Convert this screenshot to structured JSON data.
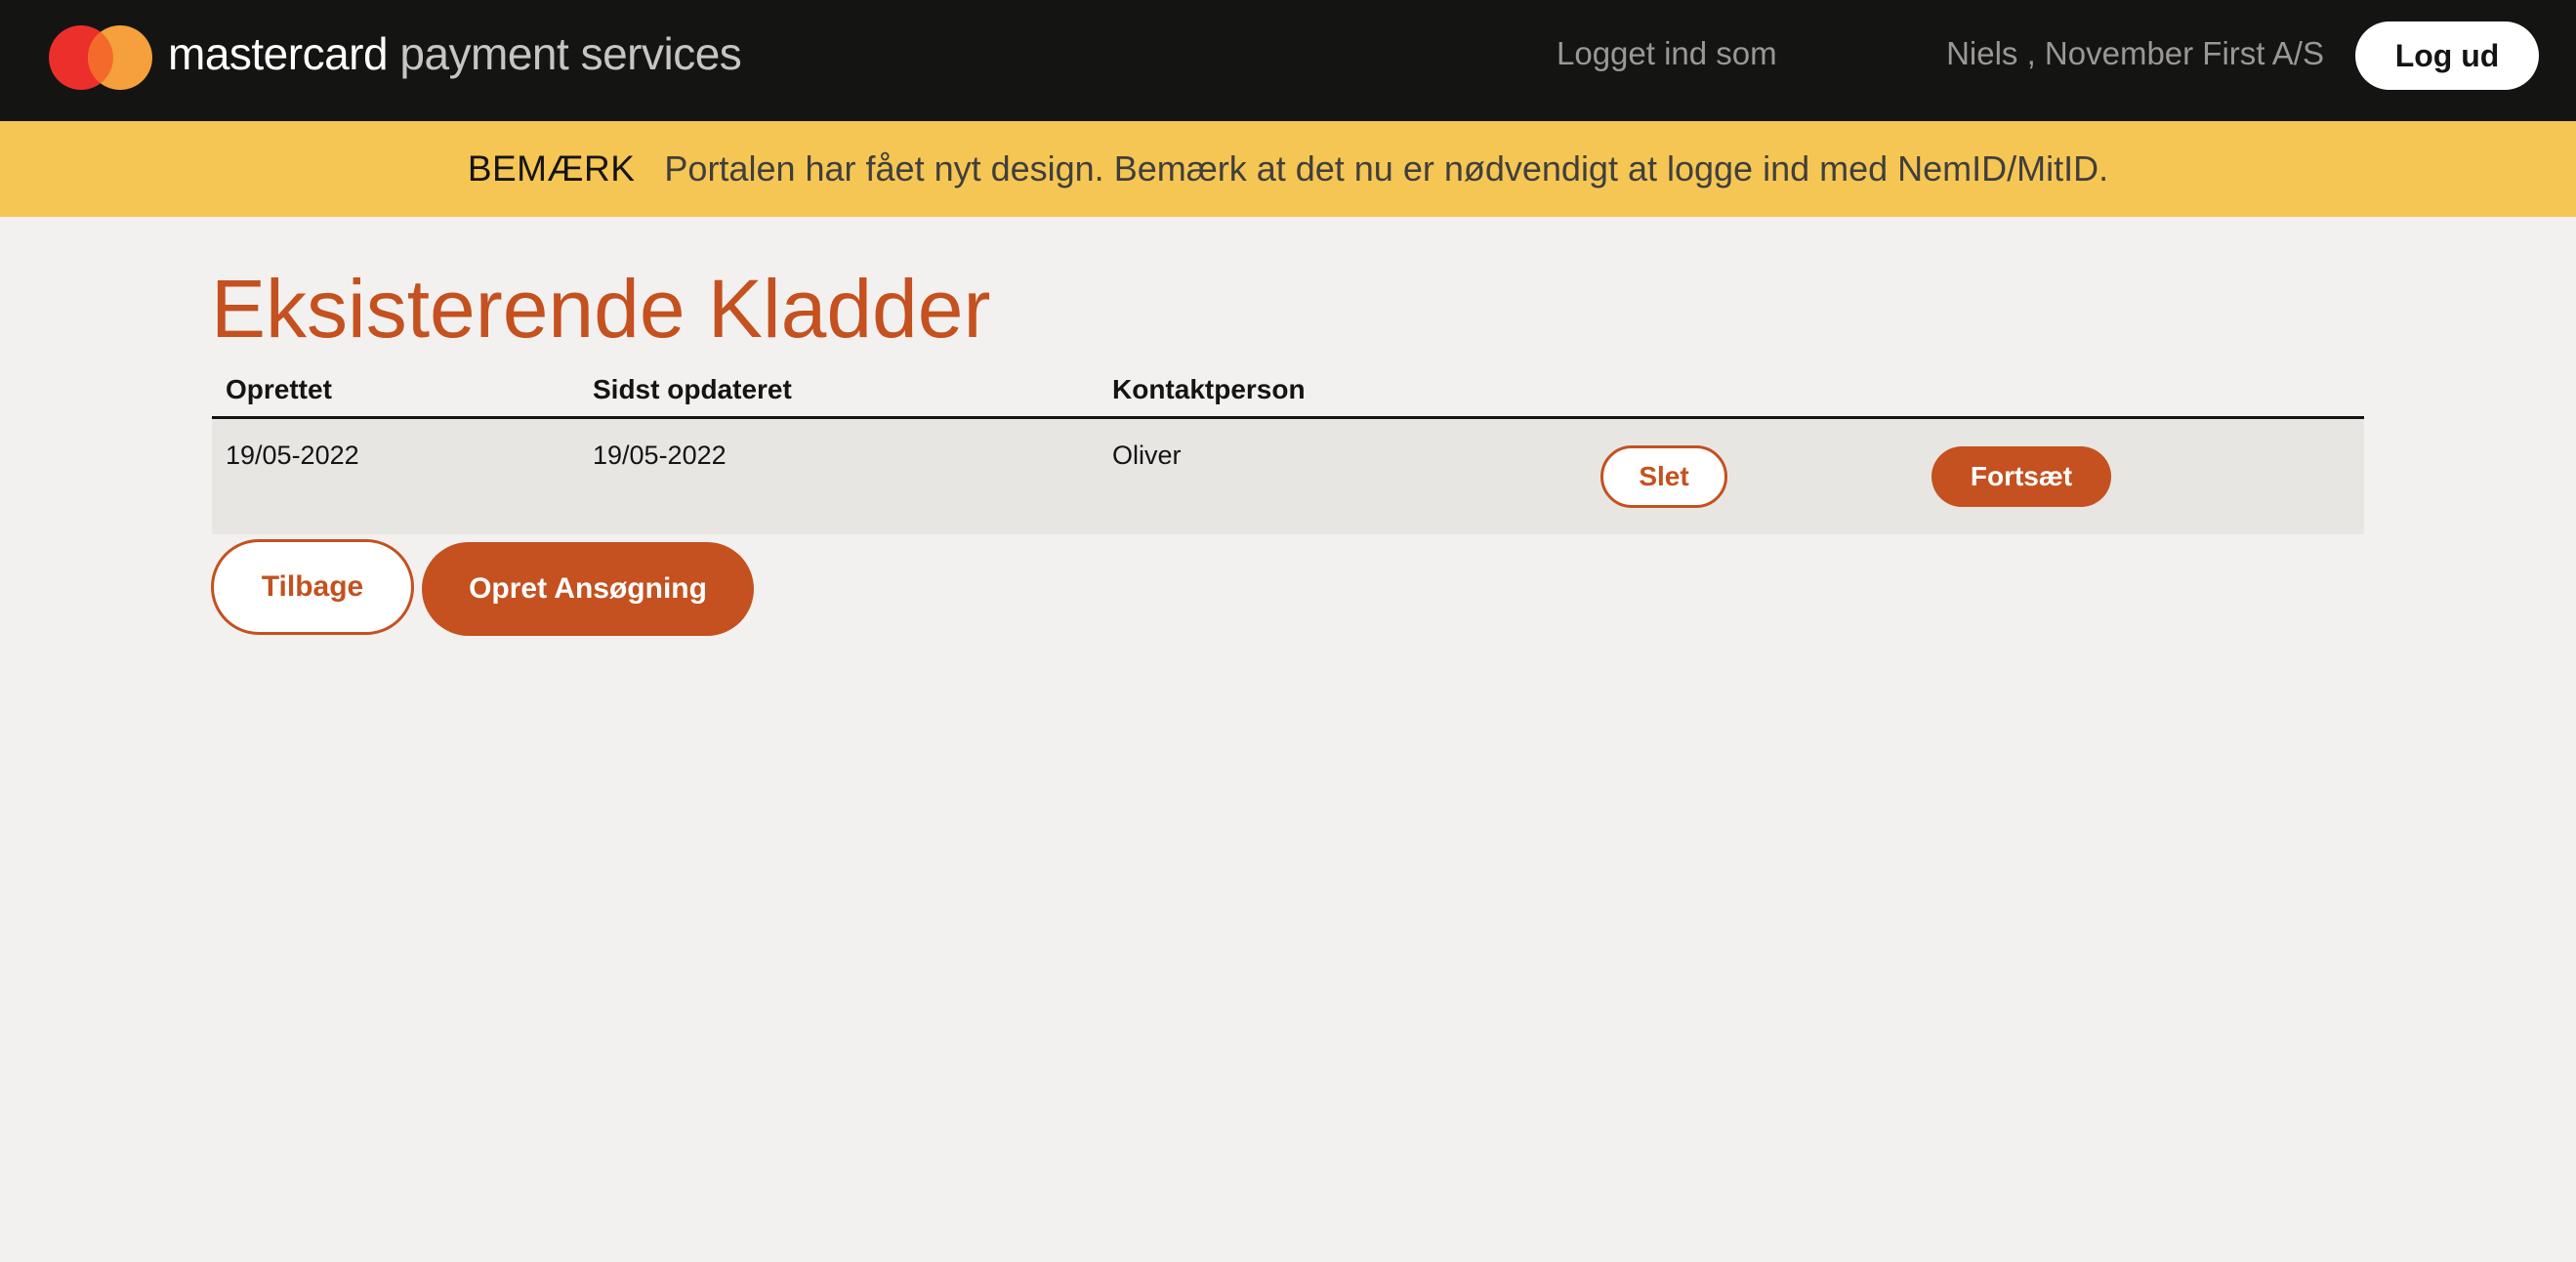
{
  "colors": {
    "header_bg": "#141413",
    "notice_bg": "#f6c654",
    "page_bg": "#f3f1ef",
    "accent": "#c4511f",
    "logo_red": "#eb001b",
    "logo_orange": "#f79e1b"
  },
  "header": {
    "logo_icon": "mastercard-circles-icon",
    "brand_primary": "mastercard",
    "brand_secondary": "payment services",
    "login_label": "Logget ind som",
    "user_name": "Niels , November First A/S",
    "logout_label": "Log ud"
  },
  "notice": {
    "label": "BEMÆRK",
    "text": "Portalen har fået nyt design. Bemærk at det nu er nødvendigt at logge ind med NemID/MitID."
  },
  "main": {
    "title": "Eksisterende Kladder",
    "table": {
      "columns": [
        "Oprettet",
        "Sidst opdateret",
        "Kontaktperson"
      ],
      "rows": [
        {
          "created": "19/05-2022",
          "updated": "19/05-2022",
          "contact": "Oliver",
          "delete_label": "Slet",
          "continue_label": "Fortsæt"
        }
      ]
    },
    "back_label": "Tilbage",
    "create_label": "Opret Ansøgning"
  }
}
